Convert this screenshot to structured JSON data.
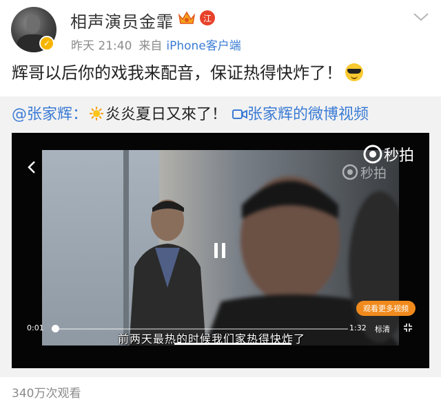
{
  "header": {
    "username": "相声演员金霏",
    "verify_glyph": "✓",
    "province_badge": "江",
    "time": "昨天 21:40",
    "source_prefix": "来自",
    "device": "iPhone客户端",
    "icons": [
      "avatar",
      "vip-crown-icon",
      "verified-icon",
      "chevron-down-icon"
    ]
  },
  "post": {
    "text": "辉哥以后你的戏我来配音，保证热得快炸了！",
    "emoji": "sunglasses-emoji"
  },
  "repost": {
    "mention": "@张家辉",
    "colon": "：",
    "text": "炎炎夏日又來了！",
    "video_link": "张家辉的微博视频"
  },
  "player": {
    "logo": "秒拍",
    "more_videos_label": "观看更多视频",
    "time_current": "0:01",
    "time_total": "1:32",
    "quality_label": "标清",
    "subtitle": "前两天最热的时候我们家热得快炸了",
    "progress": 0.01,
    "state": "paused"
  },
  "footer": {
    "view_count": "340万次观看"
  },
  "colors": {
    "link": "#3a7bd5",
    "meta": "#8b8b8b",
    "accent_orange": "#f08a1c"
  }
}
